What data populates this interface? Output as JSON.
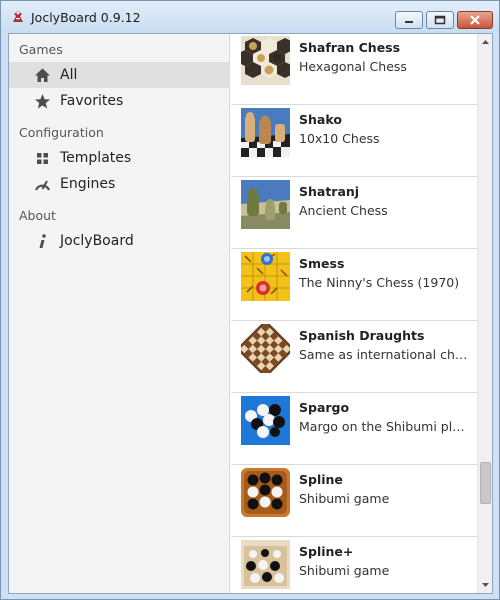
{
  "window": {
    "title": "JoclyBoard 0.9.12"
  },
  "sidebar": {
    "sections": [
      {
        "header": "Games",
        "items": [
          {
            "label": "All",
            "icon": "home-icon",
            "selected": true
          },
          {
            "label": "Favorites",
            "icon": "star-icon",
            "selected": false
          }
        ]
      },
      {
        "header": "Configuration",
        "items": [
          {
            "label": "Templates",
            "icon": "grid-icon",
            "selected": false
          },
          {
            "label": "Engines",
            "icon": "gauge-icon",
            "selected": false
          }
        ]
      },
      {
        "header": "About",
        "items": [
          {
            "label": "JoclyBoard",
            "icon": "info-icon",
            "selected": false
          }
        ]
      }
    ]
  },
  "games": [
    {
      "name": "Shafran Chess",
      "description": "Hexagonal Chess",
      "thumbnail": "hexagonal-board-icon"
    },
    {
      "name": "Shako",
      "description": "10x10 Chess",
      "thumbnail": "wooden-chess-pieces-icon"
    },
    {
      "name": "Shatranj",
      "description": "Ancient Chess",
      "thumbnail": "green-board-pieces-icon"
    },
    {
      "name": "Smess",
      "description": "The Ninny's Chess (1970)",
      "thumbnail": "yellow-arrow-board-icon"
    },
    {
      "name": "Spanish Draughts",
      "description": "Same as international check...",
      "thumbnail": "checkers-board-icon"
    },
    {
      "name": "Spargo",
      "description": "Margo on the Shibumi platform",
      "thumbnail": "blue-spheres-board-icon"
    },
    {
      "name": "Spline",
      "description": "Shibumi game",
      "thumbnail": "orange-spheres-board-icon"
    },
    {
      "name": "Spline+",
      "description": "Shibumi game",
      "thumbnail": "beige-spheres-board-icon"
    }
  ],
  "scrollbar": {
    "position": 0.85
  }
}
